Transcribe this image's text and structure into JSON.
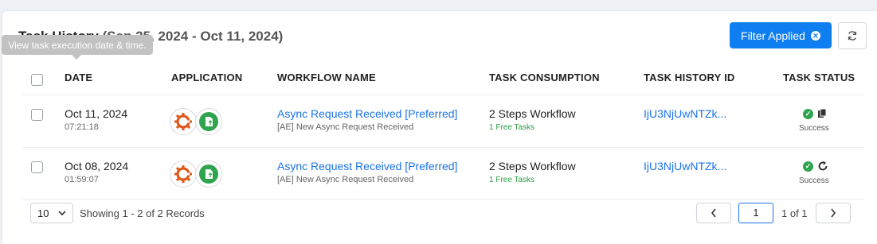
{
  "header": {
    "title": "Task History",
    "range": "(Sep 25, 2024 - Oct 11, 2024)",
    "filter_label": "Filter Applied"
  },
  "tooltip": "View task execution date & time.",
  "columns": [
    "DATE",
    "APPLICATION",
    "WORKFLOW NAME",
    "TASK CONSUMPTION",
    "TASK HISTORY ID",
    "TASK STATUS"
  ],
  "rows": [
    {
      "date": "Oct 11, 2024",
      "time": "07:21:18",
      "workflow": "Async Request Received [Preferred]",
      "workflow_sub": "[AE] New Async Request Received",
      "consumption": "2 Steps Workflow",
      "consumption_sub": "1 Free Tasks",
      "history_id": "IjU3NjUwNTZk...",
      "status": "Success",
      "status_action": "copy-icon"
    },
    {
      "date": "Oct 08, 2024",
      "time": "01:59:07",
      "workflow": "Async Request Received [Preferred]",
      "workflow_sub": "[AE] New Async Request Received",
      "consumption": "2 Steps Workflow",
      "consumption_sub": "1 Free Tasks",
      "history_id": "IjU3NjUwNTZk...",
      "status": "Success",
      "status_action": "retry-icon"
    }
  ],
  "pagination": {
    "page_size": "10",
    "showing": "Showing 1 - 2 of 2 Records",
    "current_page": "1",
    "of_text": "1 of 1"
  },
  "colors": {
    "accent": "#0f7ef0",
    "success": "#2ea44f",
    "app_orange": "#e0581a",
    "app_green": "#2ea44f"
  }
}
